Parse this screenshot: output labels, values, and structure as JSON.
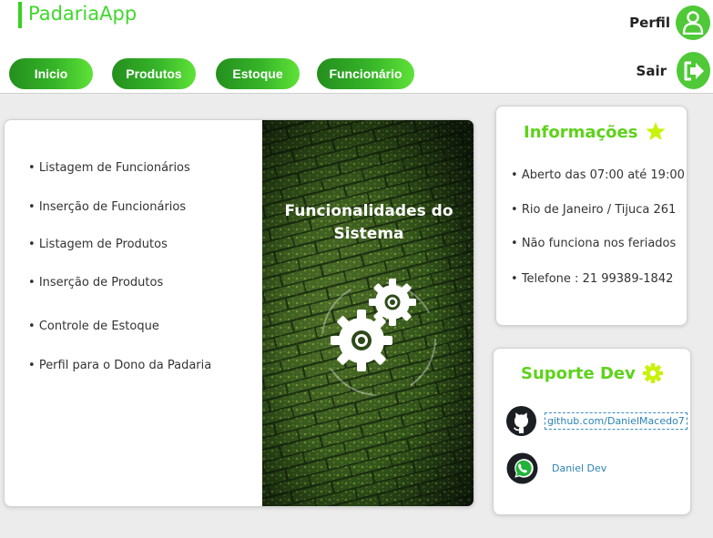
{
  "header": {
    "brand": "PadariaApp",
    "nav": [
      {
        "label": "Inicio"
      },
      {
        "label": "Produtos"
      },
      {
        "label": "Estoque"
      },
      {
        "label": "Funcionário"
      }
    ],
    "profile_label": "Perfil",
    "logout_label": "Sair"
  },
  "features": {
    "items": [
      "Listagem de Funcionários",
      "Inserção de Funcionários",
      "Listagem de Produtos",
      "Inserção de Produtos",
      "Controle de Estoque",
      "Perfil para o Dono da Padaria"
    ],
    "image_title_line1": "Funcionalidades do",
    "image_title_line2": "Sistema"
  },
  "info": {
    "title": "Informações",
    "items": [
      "Aberto das 07:00 até 19:00",
      "Rio de Janeiro / Tijuca 261",
      "Não funciona nos feriados",
      "Telefone : 21 99389-1842"
    ]
  },
  "support": {
    "title": "Suporte Dev",
    "github": "github.com/DanielMacedo7",
    "whatsapp": "Daniel Dev"
  },
  "icons": {
    "profile": "user-icon",
    "logout": "sign-out-icon",
    "info": "star-icon",
    "support": "gear-icon",
    "github": "github-icon",
    "whatsapp": "whatsapp-icon",
    "feature_image": "gears-icon"
  },
  "colors": {
    "brand_green": "#3fd82a",
    "nav_green_dark": "#248f1e",
    "nav_green_light": "#5fe238",
    "title_green": "#5ed21b",
    "star_yellow": "#c9f20c",
    "link_blue": "#2b82b4"
  }
}
